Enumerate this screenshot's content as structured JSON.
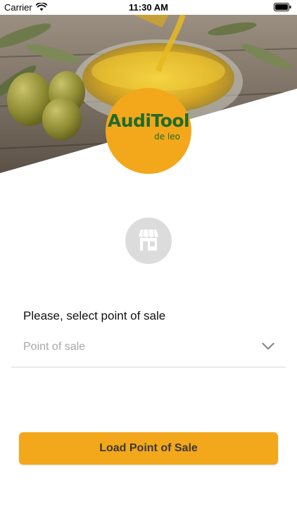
{
  "status_bar": {
    "carrier": "Carrier",
    "time": "11:30 AM"
  },
  "logo": {
    "title": "AudiTool",
    "subtitle": "de leo"
  },
  "colors": {
    "accent": "#f3a71a",
    "logo_green": "#1f6b2a",
    "placeholder": "#a8a8a8"
  },
  "icons": {
    "store": "store-icon",
    "chevron": "chevron-down-icon"
  },
  "form": {
    "label": "Please, select point of sale",
    "placeholder": "Point of sale"
  },
  "actions": {
    "load_label": "Load Point of Sale"
  }
}
